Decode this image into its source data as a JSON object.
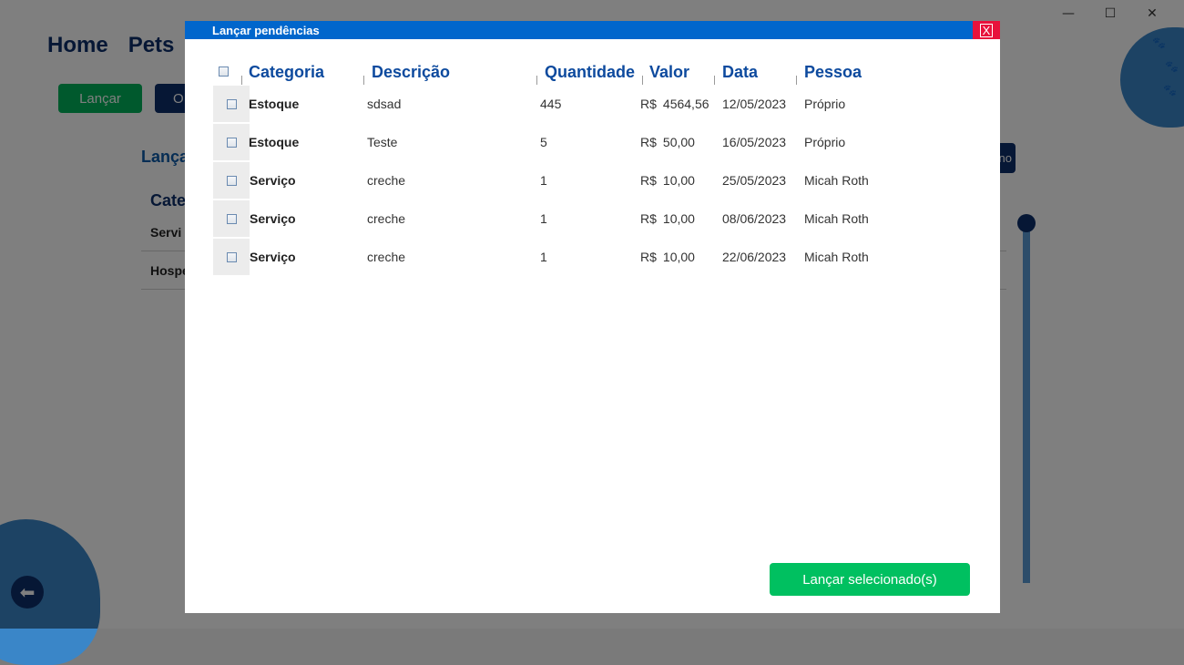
{
  "window": {
    "minimize": "—",
    "maximize": "☐",
    "close": "✕"
  },
  "background": {
    "nav": [
      "Home",
      "Pets"
    ],
    "buttons": {
      "lancar": "Lançar",
      "other": "O",
      "right": "no"
    },
    "heading": "Lança",
    "column": "Cate",
    "rows": [
      "Servi",
      "Hospe"
    ],
    "back_icon": "⬅",
    "paw_icon": "🐾"
  },
  "modal": {
    "title": "Lançar pendências",
    "close_label": "X",
    "columns": {
      "categoria": "Categoria",
      "descricao": "Descrição",
      "quantidade": "Quantidade",
      "valor": "Valor",
      "data": "Data",
      "pessoa": "Pessoa"
    },
    "rows": [
      {
        "categoria": "Estoque",
        "descricao": "sdsad",
        "quantidade": "445",
        "currency": "R$",
        "valor": "4564,56",
        "data": "12/05/2023",
        "pessoa": "Próprio"
      },
      {
        "categoria": "Estoque",
        "descricao": "Teste",
        "quantidade": "5",
        "currency": "R$",
        "valor": "50,00",
        "data": "16/05/2023",
        "pessoa": "Próprio"
      },
      {
        "categoria": "Serviço",
        "descricao": "creche",
        "quantidade": "1",
        "currency": "R$",
        "valor": "10,00",
        "data": "25/05/2023",
        "pessoa": "Micah Roth"
      },
      {
        "categoria": "Serviço",
        "descricao": "creche",
        "quantidade": "1",
        "currency": "R$",
        "valor": "10,00",
        "data": "08/06/2023",
        "pessoa": "Micah Roth"
      },
      {
        "categoria": "Serviço",
        "descricao": "creche",
        "quantidade": "1",
        "currency": "R$",
        "valor": "10,00",
        "data": "22/06/2023",
        "pessoa": "Micah Roth"
      }
    ],
    "action_button": "Lançar selecionado(s)"
  }
}
